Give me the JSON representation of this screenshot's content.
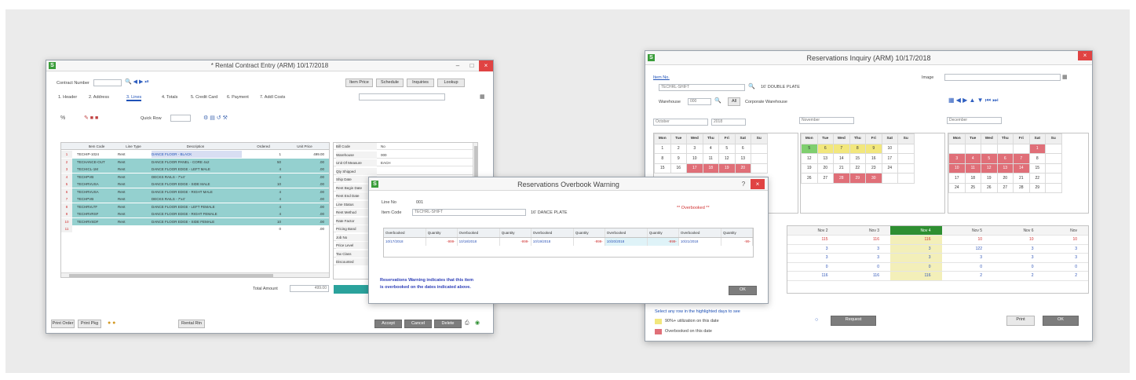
{
  "rental": {
    "title": "* Rental Contract Entry (ARM) 10/17/2018",
    "contract_label": "Contract Number",
    "tabs": [
      "1. Header",
      "2. Address",
      "3. Lines",
      "4. Totals",
      "5. Credit Card",
      "6. Payment",
      "7. Addl Costs"
    ],
    "top_buttons": [
      "Item Price",
      "Schedule",
      "Inquiries",
      "Lookup"
    ],
    "quick_row_label": "Quick Row",
    "columns": [
      "Item Code",
      "Line Type",
      "Description",
      "Ordered",
      "Unit Price"
    ],
    "rows": [
      {
        "n": "1",
        "code": "TECHIP-1024",
        "type": "Rent",
        "desc": "DANCE FLOOR - BLACK",
        "ordered": "1",
        "price": "499.00"
      },
      {
        "n": "2",
        "code": "TECHANCE-OUT",
        "type": "Rent",
        "desc": "DANCE FLOOR PANEL - CORE 4x2",
        "ordered": "50",
        "price": ".00"
      },
      {
        "n": "3",
        "code": "TECHICL-1M",
        "type": "Rent",
        "desc": "DANCE FLOOR EDGE - LEFT MALE",
        "ordered": "4",
        "price": ".00"
      },
      {
        "n": "4",
        "code": "TECHPVB",
        "type": "Rent",
        "desc": "DECKS RAILS - 7'x4'",
        "ordered": "4",
        "price": ".00"
      },
      {
        "n": "5",
        "code": "TECHRVUSA",
        "type": "Rent",
        "desc": "DANCE FLOOR EDGE - SIDE MALE",
        "ordered": "10",
        "price": ".00"
      },
      {
        "n": "6",
        "code": "TECHRVUSA",
        "type": "Rent",
        "desc": "DANCE FLOOR EDGE - RIGHT MALE",
        "ordered": "4",
        "price": ".00"
      },
      {
        "n": "7",
        "code": "TECHPVB",
        "type": "Rent",
        "desc": "DECKS RAILS - 7'x4'",
        "ordered": "4",
        "price": ".00"
      },
      {
        "n": "8",
        "code": "TECHRVLTF",
        "type": "Rent",
        "desc": "DANCE FLOOR EDGE - LEFT FEMALE",
        "ordered": "4",
        "price": ".00"
      },
      {
        "n": "9",
        "code": "TECHRVRSF",
        "type": "Rent",
        "desc": "DANCE FLOOR EDGE - RIGHT FEMALE",
        "ordered": "4",
        "price": ".00"
      },
      {
        "n": "10",
        "code": "TECHRVSDF",
        "type": "Rent",
        "desc": "DANCE FLOOR EDGE - SIDE FEMALE",
        "ordered": "10",
        "price": ".00"
      },
      {
        "n": "11",
        "code": "",
        "type": "",
        "desc": "",
        "ordered": "0",
        "price": ".00"
      }
    ],
    "side_fields": [
      {
        "k": "Bill Code",
        "v": "No"
      },
      {
        "k": "Warehouse",
        "v": "000"
      },
      {
        "k": "Unit Of Measure",
        "v": "EACH"
      },
      {
        "k": "Qty Shipped",
        "v": ""
      },
      {
        "k": "Ship Date",
        "v": ""
      },
      {
        "k": "Rent Begin Date",
        "v": ""
      },
      {
        "k": "Rent End Date",
        "v": ""
      },
      {
        "k": "Line Status",
        "v": ""
      },
      {
        "k": "Rent Method",
        "v": ""
      },
      {
        "k": "Rate Factor",
        "v": ""
      },
      {
        "k": "Pricing Band",
        "v": ""
      },
      {
        "k": "Job No",
        "v": ""
      },
      {
        "k": "Price Level",
        "v": ""
      },
      {
        "k": "Tax Class",
        "v": ""
      },
      {
        "k": "Discounted",
        "v": ""
      }
    ],
    "total_label": "Total Amount",
    "total_value": "499.00",
    "bottom_buttons": [
      "Print Order",
      "Print Pkg",
      "Rental Rtn"
    ],
    "action_buttons": [
      "Accept",
      "Cancel",
      "Delete"
    ]
  },
  "overbook": {
    "title": "Reservations Overbook Warning",
    "line_no_label": "Line No",
    "line_no_value": "001",
    "item_code_label": "Item Code",
    "item_code_value": "TECHRL-SHIFT",
    "item_desc": "16' DANCE PLATE",
    "flag": "** Overbooked **",
    "columns": [
      "Overbooked",
      "Quantity",
      "Overbooked",
      "Quantity",
      "Overbooked",
      "Quantity",
      "Overbooked",
      "Quantity",
      "Overbooked",
      "Quantity"
    ],
    "row": [
      "10/17/2018",
      "-999-",
      "10/18/2018",
      "-999-",
      "10/19/2018",
      "-999-",
      "10/20/2018",
      "-999-",
      "10/21/2018",
      "-99-"
    ],
    "note_line1": "Reservations Warning indicates that this item",
    "note_line2": "is overbooked on the dates indicated above.",
    "ok_label": "OK"
  },
  "reserv": {
    "title": "Reservations Inquiry (ARM) 10/17/2018",
    "item_label": "Item No.",
    "item_value": "TECHRL-SHIFT",
    "item_desc": "16' DOUBLE PLATE",
    "image_label": "Image",
    "warehouse_label": "Warehouse",
    "warehouse_value": "000",
    "all_label": "All",
    "corp_label": "Corporate Warehouse",
    "month1": "October",
    "year1": "2018",
    "month2": "November",
    "month3": "December",
    "dow": [
      "Mon",
      "Tue",
      "Wed",
      "Thu",
      "Fri",
      "Sat",
      "Su"
    ],
    "october": [
      [
        "1",
        "2",
        "3",
        "4",
        "5",
        "6"
      ],
      [
        "8",
        "9",
        "10",
        "11",
        "12",
        "13"
      ],
      [
        "15",
        "16",
        "17",
        "18",
        "19",
        "20"
      ]
    ],
    "november": [
      [
        "5",
        "6",
        "7",
        "8",
        "9",
        "10"
      ],
      [
        "12",
        "13",
        "14",
        "15",
        "16",
        "17"
      ],
      [
        "19",
        "20",
        "21",
        "22",
        "23",
        "24"
      ],
      [
        "26",
        "27",
        "28",
        "29",
        "30",
        ""
      ]
    ],
    "december": [
      [
        "",
        "",
        "",
        "",
        "",
        "1"
      ],
      [
        "3",
        "4",
        "5",
        "6",
        "7",
        "8"
      ],
      [
        "10",
        "11",
        "12",
        "13",
        "14",
        "15"
      ],
      [
        "17",
        "18",
        "19",
        "20",
        "21",
        "22"
      ],
      [
        "24",
        "25",
        "26",
        "27",
        "28",
        "29"
      ]
    ],
    "day_headers": [
      "Nov 2",
      "Nov 3",
      "Nov 4",
      "Nov 5",
      "Nov 6",
      "Nov"
    ],
    "day_rows": [
      [
        "115",
        "116",
        "116",
        "10",
        "10",
        "10"
      ],
      [
        "3",
        "3",
        "3",
        "122",
        "3",
        "3"
      ],
      [
        "3",
        "3",
        "3",
        "3",
        "3",
        "3"
      ],
      [
        "0",
        "0",
        "0",
        "0",
        "0",
        "0"
      ],
      [
        "116",
        "116",
        "116",
        "2",
        "2",
        "2"
      ]
    ],
    "hint": "Select any row in the highlighted days to see",
    "legend": [
      {
        "color": "#f2e77d",
        "text": "90%+ utilization on this date"
      },
      {
        "color": "#e06f78",
        "text": "Overbooked on this date"
      }
    ],
    "history_label": "Request",
    "print_label": "Print",
    "ok_label": "OK"
  }
}
